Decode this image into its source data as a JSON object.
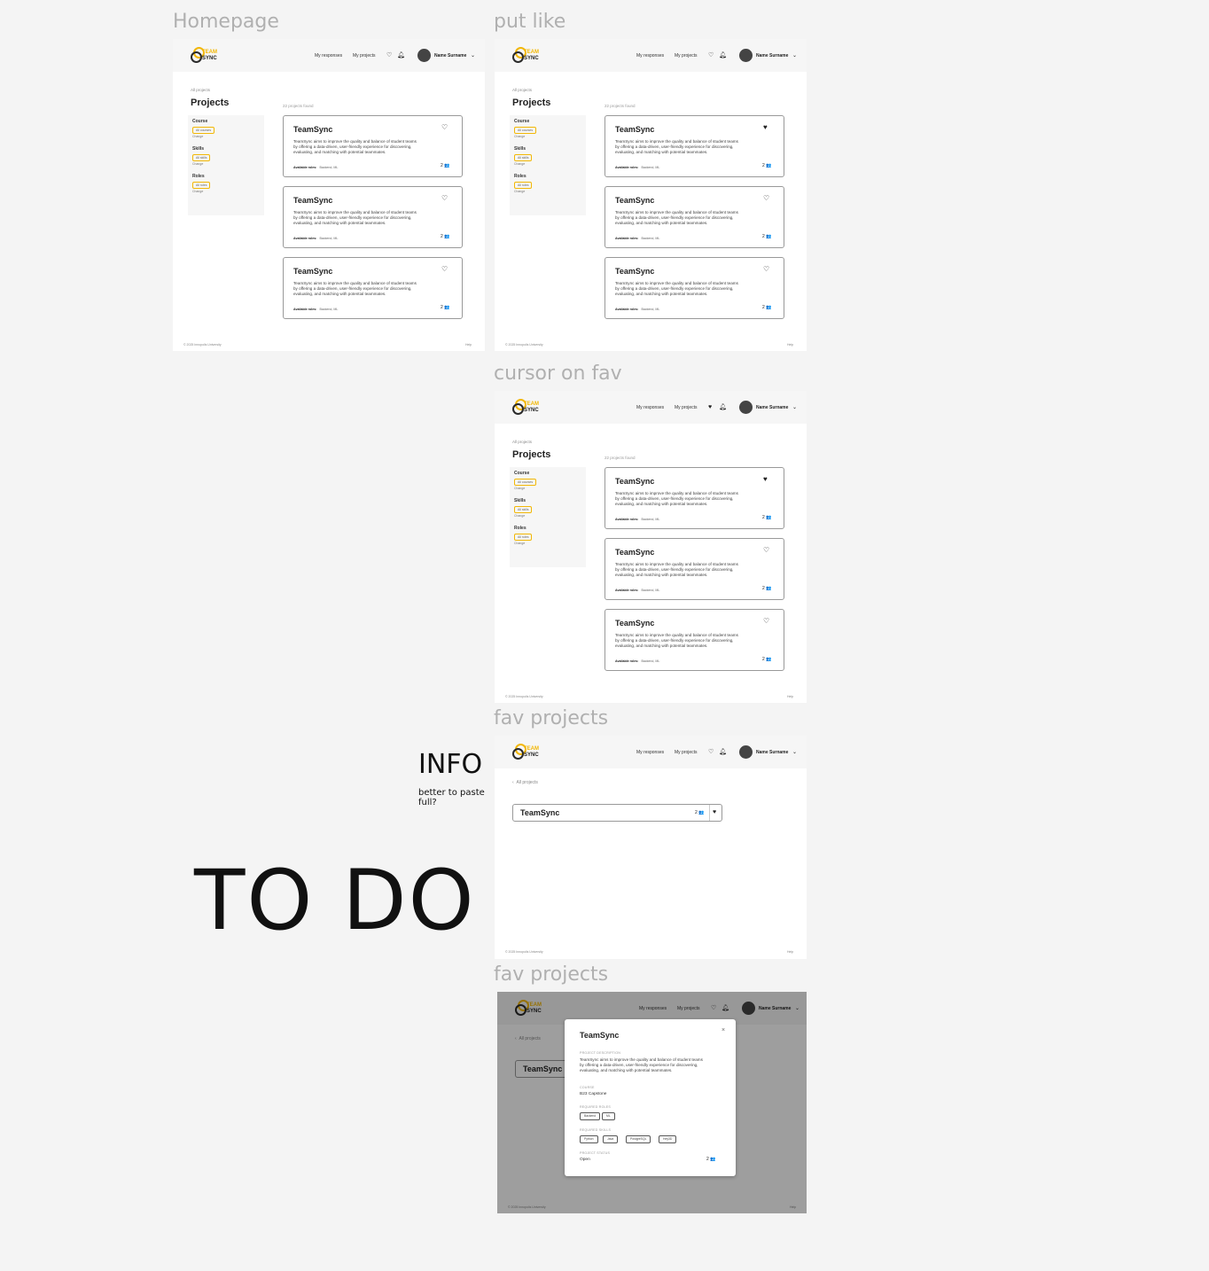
{
  "frame_labels": [
    "Homepage",
    "put like",
    "cursor on fav",
    "fav projects",
    "fav projects"
  ],
  "header": {
    "logo_top": "TEAM",
    "logo_bottom": "SYNC",
    "nav_responses": "My responses",
    "nav_projects": "My projects",
    "user_name": "Name Surname",
    "icons": [
      "heart-icon",
      "bell-icon",
      "chevron-down-icon"
    ]
  },
  "projects_page": {
    "breadcrumb": "All projects",
    "title": "Projects",
    "found": "22 projects found",
    "filters": [
      {
        "label": "Course",
        "chip": "All courses",
        "change": "Change"
      },
      {
        "label": "Skills",
        "chip": "All skills",
        "change": "Change"
      },
      {
        "label": "Roles",
        "chip": "All roles",
        "change": "Change"
      }
    ]
  },
  "card": {
    "title": "TeamSync",
    "description": "TeamSync aims to improve the quality and balance of student teams by offering a data-driven, user-friendly experience for discovering, evaluating, and matching with potential teammates.",
    "roles_label": "Available roles:",
    "roles_value": "Backend, ML",
    "count": "2"
  },
  "fav_page": {
    "back": "All projects",
    "row_title": "TeamSync",
    "row_count": "2"
  },
  "modal": {
    "title": "TeamSync",
    "close": "×",
    "desc_label": "PROJECT DESCRIPTION",
    "course_label": "COURSE",
    "course_value": "B23 Capstone",
    "roles_label": "REQUIRED ROLES",
    "roles": [
      "Backend",
      "ML"
    ],
    "skills_label": "REQUIRED SKILLS",
    "skills": [
      "Python",
      "Java",
      "PostgreSQL",
      "Hey3D"
    ],
    "status_label": "PROJECT STATUS",
    "status_value": "Open",
    "count": "2"
  },
  "footer": {
    "copyright": "© 2025 Innopolis University",
    "help": "Help"
  },
  "annotations": {
    "info": "INFO",
    "note": "better to paste full?",
    "todo": "TO DO"
  }
}
